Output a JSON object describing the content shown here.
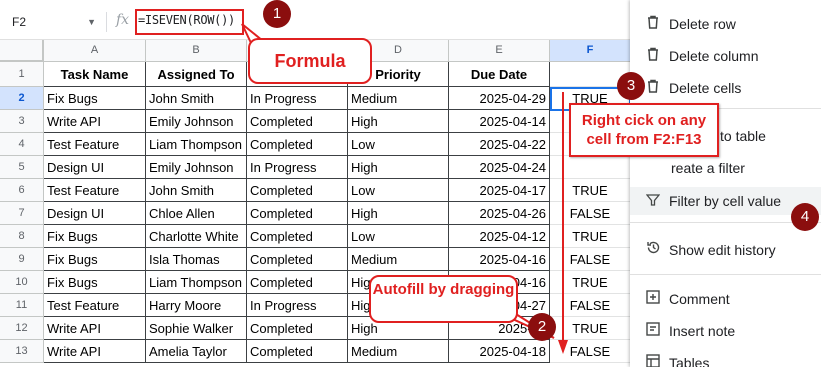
{
  "formula_bar": {
    "name_box": "F2",
    "fx": "fx",
    "formula": "=ISEVEN(ROW())"
  },
  "columns": [
    "A",
    "B",
    "C",
    "D",
    "E",
    "F"
  ],
  "rows": [
    "1",
    "2",
    "3",
    "4",
    "5",
    "6",
    "7",
    "8",
    "9",
    "10",
    "11",
    "12",
    "13"
  ],
  "header_row": [
    "Task Name",
    "Assigned To",
    "",
    "Priority",
    "Due Date"
  ],
  "data_rows": [
    [
      "Fix Bugs",
      "John Smith",
      "In Progress",
      "Medium",
      "2025-04-29",
      "TRUE"
    ],
    [
      "Write API",
      "Emily Johnson",
      "Completed",
      "High",
      "2025-04-14",
      ""
    ],
    [
      "Test Feature",
      "Liam Thompson",
      "Completed",
      "Low",
      "2025-04-22",
      ""
    ],
    [
      "Design UI",
      "Emily Johnson",
      "In Progress",
      "High",
      "2025-04-24",
      ""
    ],
    [
      "Test Feature",
      "John Smith",
      "Completed",
      "Low",
      "2025-04-17",
      "TRUE"
    ],
    [
      "Design UI",
      "Chloe Allen",
      "Completed",
      "High",
      "2025-04-26",
      "FALSE"
    ],
    [
      "Fix Bugs",
      "Charlotte White",
      "Completed",
      "Low",
      "2025-04-12",
      "TRUE"
    ],
    [
      "Fix Bugs",
      "Isla Thomas",
      "Completed",
      "Medium",
      "2025-04-16",
      "FALSE"
    ],
    [
      "Fix Bugs",
      "Liam Thompson",
      "Completed",
      "Hig",
      "2025-04-16",
      "TRUE"
    ],
    [
      "Test Feature",
      "Harry Moore",
      "In Progress",
      "Hig",
      "2025-04-27",
      "FALSE"
    ],
    [
      "Write API",
      "Sophie Walker",
      "Completed",
      "High",
      "2025-04",
      "TRUE"
    ],
    [
      "Write API",
      "Amelia Taylor",
      "Completed",
      "Medium",
      "2025-04-18",
      "FALSE"
    ]
  ],
  "menu": {
    "items": [
      {
        "label": "Delete row",
        "icon": "trash-icon"
      },
      {
        "label": "Delete column",
        "icon": "trash-icon"
      },
      {
        "label": "Delete cells",
        "icon": "trash-icon"
      },
      {
        "label": "to table",
        "icon": "table-icon"
      },
      {
        "label": "reate a filter",
        "icon": "filter-icon"
      },
      {
        "label": "Filter by cell value",
        "icon": "filter-icon"
      },
      {
        "label": "Show edit history",
        "icon": "history-icon"
      },
      {
        "label": "Comment",
        "icon": "comment-plus-icon"
      },
      {
        "label": "Insert note",
        "icon": "note-icon"
      },
      {
        "label": "Tables",
        "icon": "table-icon"
      }
    ]
  },
  "annotations": {
    "formula_label": "Formula",
    "right_click_label": "Right cick on any cell from F2:F13",
    "autofill_label": "Autofill by dragging",
    "badge_1": "1",
    "badge_2": "2",
    "badge_3": "3",
    "badge_4": "4"
  },
  "colors": {
    "annotation_red": "#e02020",
    "badge_dark_red": "#8b0e0e",
    "selection_blue": "#1a73e8"
  }
}
